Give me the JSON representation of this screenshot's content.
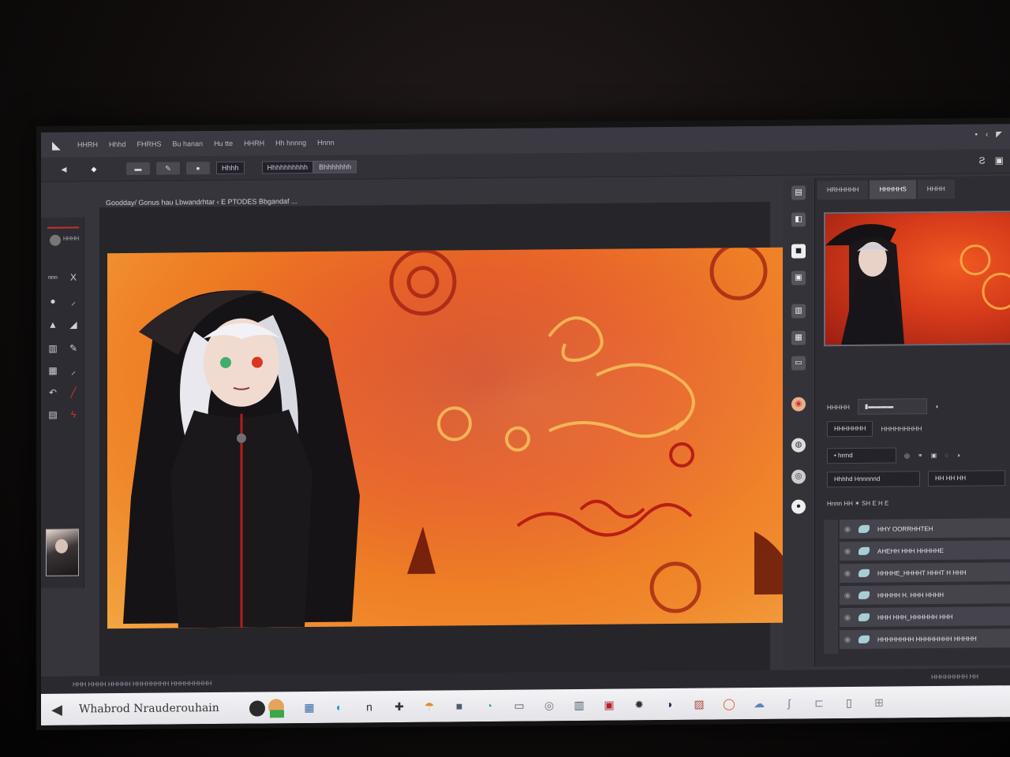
{
  "app": {
    "menu_items": [
      "HHRH",
      "Hhhd",
      "FHRHS",
      "Bu hanan",
      "Hu tte",
      "HHRH",
      "Hh hnnng",
      "Hnnn"
    ],
    "window_controls": [
      "•",
      "‹",
      "◤"
    ]
  },
  "toolbar": {
    "buttons": [
      "▬",
      "✎",
      "●"
    ],
    "field_a": "Hhhh",
    "field_b": "Hhhhhhhhhh",
    "field_c": "Bhhhhhhh",
    "right_icons": [
      "Ƨ",
      "▣"
    ]
  },
  "document": {
    "tab_title": "Goodday/ Gonus hau Lbwandrhtar  ‹  E  PTODES Bbgandaf  ..."
  },
  "tools": {
    "swatch_label": "HHHH",
    "rows": [
      [
        "nnn",
        "X"
      ],
      [
        "●",
        "⸝"
      ],
      [
        "▲",
        "◢"
      ],
      [
        "▥",
        "✎"
      ],
      [
        "▦",
        "⸝"
      ],
      [
        "↶",
        "╱"
      ],
      [
        "▤",
        "ϟ"
      ]
    ]
  },
  "right_panel": {
    "tabs": [
      "HRHHHHH",
      "HHHHHS",
      "HHHH"
    ],
    "row1_label": "HHHHH",
    "row2_label": "HHHHHHH",
    "row2_value": "HHHHHHHHH",
    "dropdown_value": "• hrrnd",
    "field_left": "Hhhhd Hnnnnnd",
    "field_right": "HH HH HH",
    "layers_header": "Hnnn  HH  ✶  SH E H E",
    "layers": [
      "HHY OORRHHTEH",
      "AHEHH HHH HHHHHE",
      "HHHHE_HHHHT HHHT H HHH",
      "HHHHH  H.  HHH HHHH",
      "HHH HHH_HHHHHH HHH",
      "HHHHHHHH HHHHHHHH HHHHH"
    ]
  },
  "status": {
    "left": "HHH HHHH HHHHH   HHHHHHHH HHHHHHHHH",
    "right": "HHHHHHHH  HH"
  },
  "taskbar": {
    "title": "Whabrod Nrauderouhain",
    "icons": [
      {
        "name": "files-icon",
        "glyph": "▦",
        "color": "#3a6ea5"
      },
      {
        "name": "edge-icon",
        "glyph": "◐",
        "color": "#1aa3c9"
      },
      {
        "name": "n-app-icon",
        "glyph": "n",
        "color": "#2b2b2b"
      },
      {
        "name": "puzzle-icon",
        "glyph": "✚",
        "color": "#333333"
      },
      {
        "name": "pin-icon",
        "glyph": "☂",
        "color": "#e38b2d"
      },
      {
        "name": "square-app-icon",
        "glyph": "■",
        "color": "#4a6073"
      },
      {
        "name": "chrome-icon",
        "glyph": "◔",
        "color": "#2aa7a0"
      },
      {
        "name": "window-icon",
        "glyph": "▭",
        "color": "#555555"
      },
      {
        "name": "circle-app-icon",
        "glyph": "◎",
        "color": "#777777"
      },
      {
        "name": "computer-icon",
        "glyph": "▥",
        "color": "#4d5d6c"
      },
      {
        "name": "media-icon",
        "glyph": "▣",
        "color": "#b3222a"
      },
      {
        "name": "settings-icon",
        "glyph": "✹",
        "color": "#333333"
      },
      {
        "name": "moon-icon",
        "glyph": "◑",
        "color": "#1f2f52"
      },
      {
        "name": "photos-icon",
        "glyph": "▨",
        "color": "#a84c3c"
      },
      {
        "name": "ring-icon",
        "glyph": "◯",
        "color": "#e8541f"
      },
      {
        "name": "cloud-icon",
        "glyph": "☁",
        "color": "#5b85b8"
      },
      {
        "name": "hook-icon",
        "glyph": "ʃ",
        "color": "#6b7f93"
      },
      {
        "name": "tray-icon",
        "glyph": "⊏",
        "color": "#7b8b9b"
      },
      {
        "name": "desktop-icon",
        "glyph": "▯",
        "color": "#5a5a5a"
      },
      {
        "name": "grid-icon",
        "glyph": "⊞",
        "color": "#888888"
      }
    ]
  },
  "colors": {
    "accent_red": "#c7312a",
    "panel_dark": "#2e2d34",
    "art_orange": "#ee7a20"
  }
}
